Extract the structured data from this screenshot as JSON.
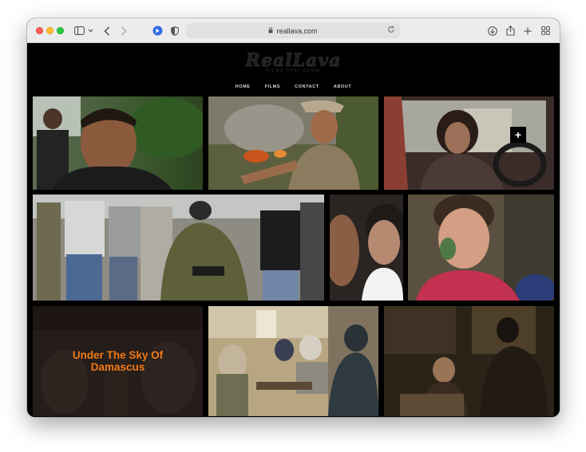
{
  "browser": {
    "url": "reallava.com",
    "colors": {
      "close": "#fe5f57",
      "minimize": "#febc2e",
      "zoom": "#28c840"
    },
    "icons": [
      "sidebar-icon",
      "chevron-down-icon",
      "back-icon",
      "forward-icon",
      "extension-icon",
      "shield-icon",
      "lock-icon",
      "reload-icon",
      "download-icon",
      "share-icon",
      "new-tab-icon",
      "tab-overview-icon"
    ]
  },
  "site": {
    "logo": {
      "title": "RealLava",
      "tagline": "FILMS THAT GLOW"
    },
    "nav": [
      "HOME",
      "FILMS",
      "CONTACT",
      "ABOUT"
    ],
    "accent_color": "#f07a17",
    "grid": {
      "hover_plus": "+",
      "featured_caption": "Under The Sky Of Damascus"
    }
  }
}
